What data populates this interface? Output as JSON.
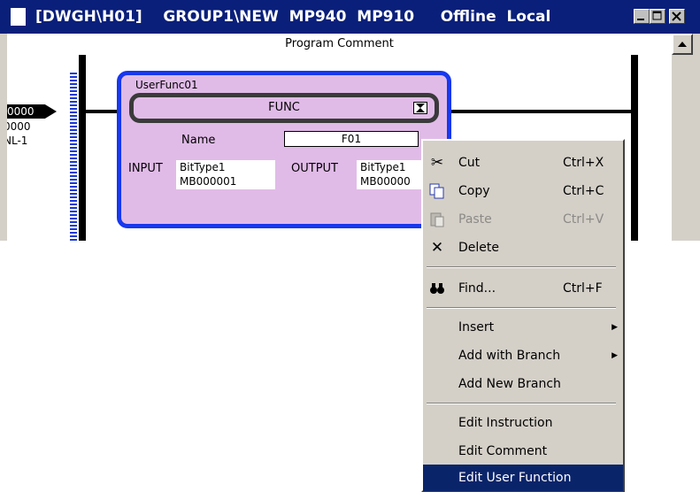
{
  "window": {
    "title": "[DWGH\\H01]    GROUP1\\NEW  MP940  MP910     Offline  Local",
    "minimize_glyph": "minimize-icon",
    "maximize_glyph": "maximize-icon",
    "close_glyph": "close-icon"
  },
  "ladder": {
    "program_comment": "Program Comment",
    "step_number": "0000",
    "step_line2": "0000",
    "step_line3": "NL-1"
  },
  "function_block": {
    "title": "UserFunc01",
    "func_label": "FUNC",
    "name_label": "Name",
    "name_value": "F01",
    "input_label": "INPUT",
    "input_type": "BitType1",
    "input_address": "MB000001",
    "output_label": "OUTPUT",
    "output_type": "BitType1",
    "output_address": "MB00000",
    "colors": {
      "block_fill": "#e1bbe8",
      "block_border": "#1838ee"
    }
  },
  "context_menu": {
    "items": [
      {
        "label": "Cut",
        "shortcut": "Ctrl+X",
        "icon": "scissors-icon",
        "enabled": true
      },
      {
        "label": "Copy",
        "shortcut": "Ctrl+C",
        "icon": "copy-icon",
        "enabled": true
      },
      {
        "label": "Paste",
        "shortcut": "Ctrl+V",
        "icon": "paste-icon",
        "enabled": false
      },
      {
        "label": "Delete",
        "shortcut": "",
        "icon": "delete-icon",
        "enabled": true
      },
      {
        "label": "Find...",
        "shortcut": "Ctrl+F",
        "icon": "binoculars-icon",
        "enabled": true
      },
      {
        "label": "Insert",
        "shortcut": "",
        "submenu": true,
        "enabled": true
      },
      {
        "label": "Add with Branch",
        "shortcut": "",
        "submenu": true,
        "enabled": true
      },
      {
        "label": "Add New Branch",
        "shortcut": "",
        "enabled": true
      },
      {
        "label": "Edit Instruction",
        "shortcut": "",
        "enabled": true
      },
      {
        "label": "Edit Comment",
        "shortcut": "",
        "enabled": true
      },
      {
        "label": "Edit User Function",
        "shortcut": "",
        "enabled": true,
        "highlighted": true
      }
    ],
    "colors": {
      "highlight": "#0a246a",
      "menu_bg": "#d4d0c8"
    }
  },
  "colors": {
    "titlebar": "#0a1f7a"
  }
}
